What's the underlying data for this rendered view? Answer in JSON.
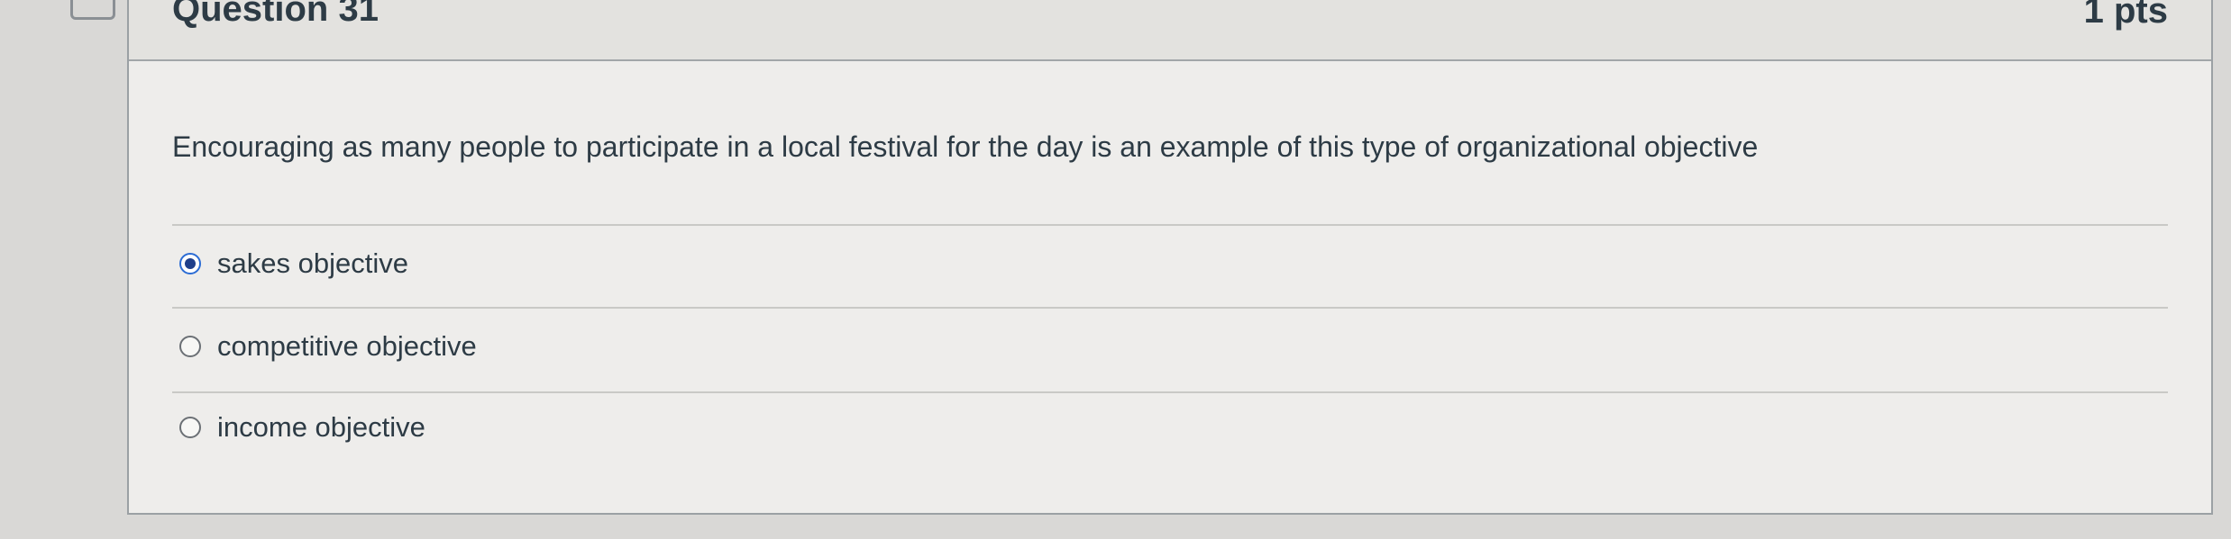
{
  "question": {
    "title": "Question 31",
    "points": "1 pts",
    "text": "Encouraging as many people to participate in a local festival for the day is an example of this type of organizational objective"
  },
  "answers": [
    {
      "label": "sakes objective",
      "selected": true
    },
    {
      "label": "competitive objective",
      "selected": false
    },
    {
      "label": "income objective",
      "selected": false
    }
  ],
  "colors": {
    "radio_selected": "#1f3f8a",
    "text": "#2d3b45"
  }
}
